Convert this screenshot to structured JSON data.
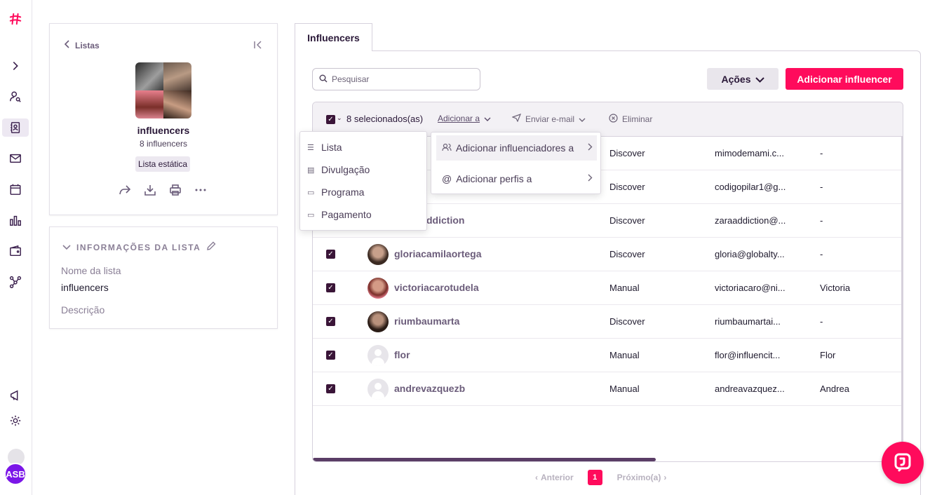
{
  "sidebar": {
    "icons": [
      "logo-hash-icon",
      "expand-chevron-icon",
      "user-search-icon",
      "contacts-book-icon",
      "mail-icon",
      "calendar-icon",
      "bar-chart-icon",
      "wallet-icon",
      "workflow-icon",
      "megaphone-icon",
      "settings-icon"
    ],
    "user_initials": "ASB",
    "accent": "#ff0b5c"
  },
  "list_card": {
    "back_label": "Listas",
    "name": "influencers",
    "count": "8 influencers",
    "badge": "Lista estática"
  },
  "info_card": {
    "title": "INFORMAÇÕES DA LISTA",
    "name_label": "Nome da lista",
    "name_value": "influencers",
    "description_label": "Descrição"
  },
  "tab": {
    "label": "Influencers"
  },
  "search": {
    "placeholder": "Pesquisar",
    "value": ""
  },
  "actions": {
    "acoes_label": "Ações",
    "add_label": "Adicionar influencer"
  },
  "toolbar": {
    "selected_label": "8 selecionados(as)",
    "add_to_label": "Adicionar a",
    "email_label": "Enviar e-mail",
    "delete_label": "Eliminar"
  },
  "menu_types": {
    "items": [
      {
        "label": "Lista",
        "icon": "list-icon"
      },
      {
        "label": "Divulgação",
        "icon": "campaign-icon"
      },
      {
        "label": "Programa",
        "icon": "ticket-icon"
      },
      {
        "label": "Pagamento",
        "icon": "card-icon"
      }
    ]
  },
  "menu_add": {
    "items": [
      {
        "label": "Adicionar influenciadores a",
        "icon": "users-icon"
      },
      {
        "label": "Adicionar perfis a",
        "icon": "at-icon"
      }
    ]
  },
  "rows": [
    {
      "handle": "",
      "origin": "Discover",
      "email": "mimodemami.c...",
      "name": "-"
    },
    {
      "handle": "",
      "origin": "Discover",
      "email": "codigopilar1@g...",
      "name": "-"
    },
    {
      "handle": "ddiction",
      "origin": "Discover",
      "email": "zaraaddiction@...",
      "name": "-"
    },
    {
      "handle": "gloriacamilaortega",
      "origin": "Discover",
      "email": "gloria@globalty...",
      "name": "-"
    },
    {
      "handle": "victoriacarotudela",
      "origin": "Manual",
      "email": "victoriacaro@ni...",
      "name": "Victoria"
    },
    {
      "handle": "riumbaumarta",
      "origin": "Discover",
      "email": "riumbaumartai...",
      "name": "-"
    },
    {
      "handle": "flor",
      "origin": "Manual",
      "email": "flor@influencit...",
      "name": "Flor"
    },
    {
      "handle": "andrevazquezb",
      "origin": "Manual",
      "email": "andreavazquez...",
      "name": "Andrea"
    }
  ],
  "pagination": {
    "prev_label": "Anterior",
    "current_page": "1",
    "next_label": "Próximo(a)"
  }
}
